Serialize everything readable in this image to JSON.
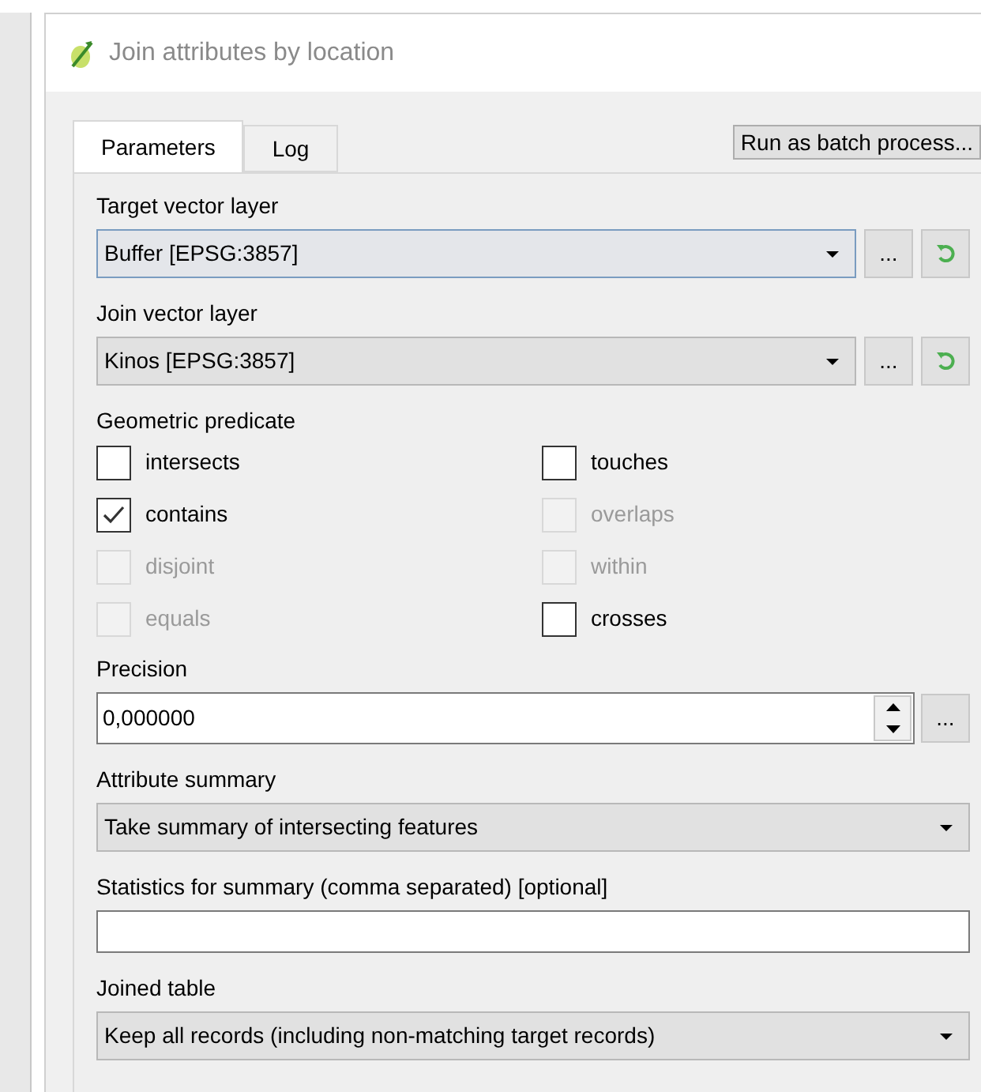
{
  "window": {
    "title": "Join attributes by location"
  },
  "tabs": [
    {
      "label": "Parameters",
      "selected": true
    },
    {
      "label": "Log",
      "selected": false
    }
  ],
  "batch_button": "Run as batch process...",
  "parameters": [
    {
      "kind": "layer",
      "label": "Target vector layer",
      "value": "Buffer [EPSG:3857]",
      "focused": true,
      "browse": "..."
    },
    {
      "kind": "layer",
      "label": "Join vector layer",
      "value": "Kinos [EPSG:3857]",
      "focused": false,
      "browse": "..."
    },
    {
      "kind": "checks",
      "label": "Geometric predicate",
      "options": [
        {
          "label": "intersects",
          "checked": false,
          "disabled": false
        },
        {
          "label": "touches",
          "checked": false,
          "disabled": false
        },
        {
          "label": "contains",
          "checked": true,
          "disabled": false
        },
        {
          "label": "overlaps",
          "checked": false,
          "disabled": true
        },
        {
          "label": "disjoint",
          "checked": false,
          "disabled": true
        },
        {
          "label": "within",
          "checked": false,
          "disabled": true
        },
        {
          "label": "equals",
          "checked": false,
          "disabled": true
        },
        {
          "label": "crosses",
          "checked": false,
          "disabled": false
        }
      ]
    },
    {
      "kind": "spin",
      "label": "Precision",
      "value": "0,000000",
      "browse": "..."
    },
    {
      "kind": "combo",
      "label": "Attribute summary",
      "value": "Take summary of intersecting features"
    },
    {
      "kind": "text",
      "label": "Statistics for summary (comma separated) [optional]"
    },
    {
      "kind": "combo",
      "label": "Joined table",
      "value": "Keep all records (including non-matching target records)"
    }
  ]
}
